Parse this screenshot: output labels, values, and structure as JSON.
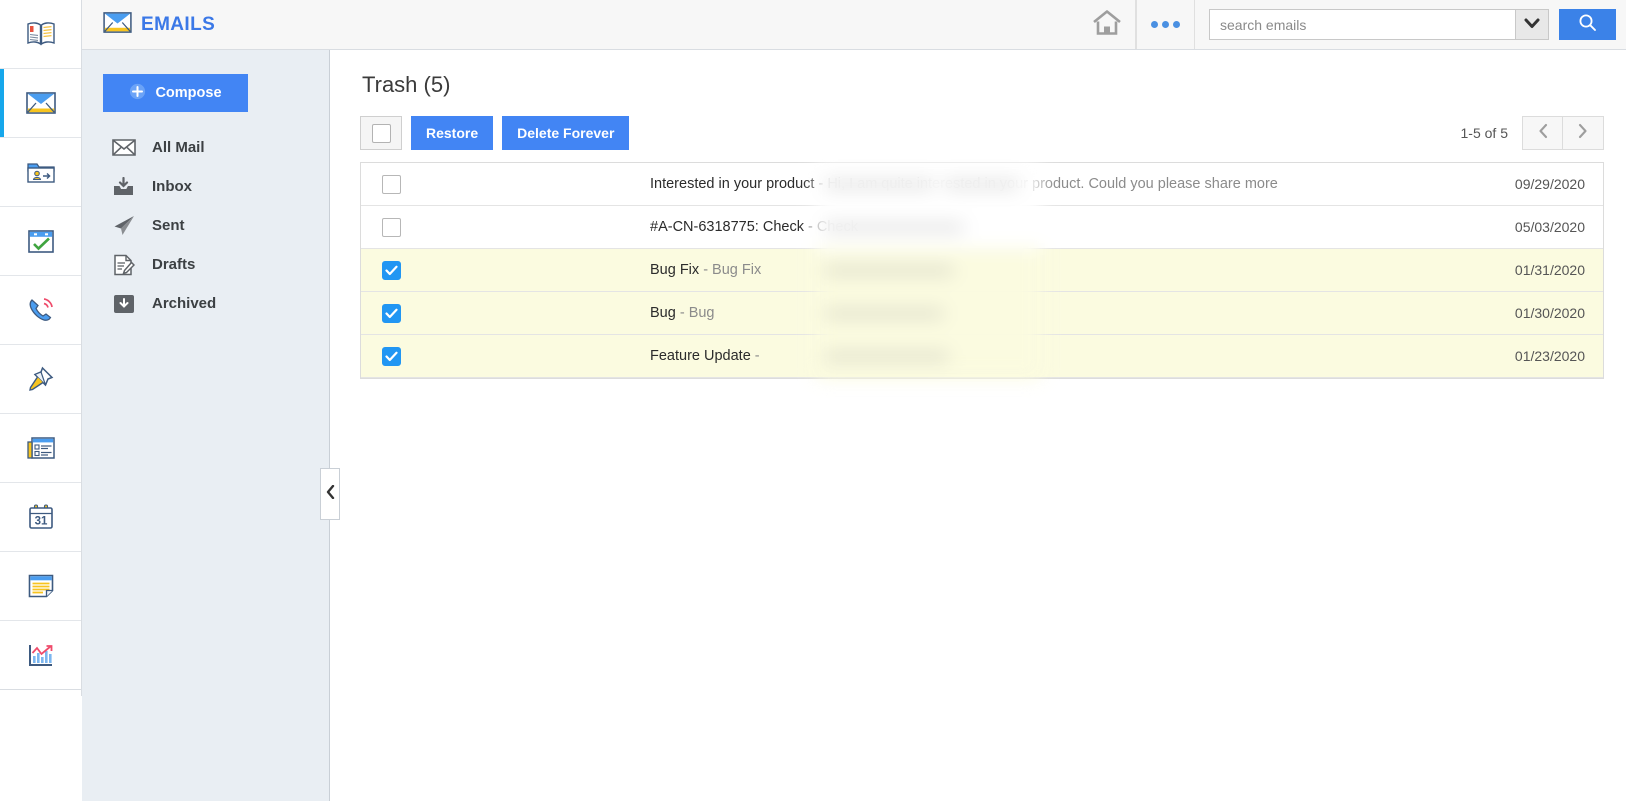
{
  "app": {
    "brand_title": "EMAILS",
    "brand_icon": "envelope-icon"
  },
  "icon_rail": {
    "items": [
      {
        "name": "address-book",
        "icon": "book-icon",
        "active": false
      },
      {
        "name": "emails",
        "icon": "envelope-icon",
        "active": true
      },
      {
        "name": "contacts",
        "icon": "contact-folder-icon",
        "active": false
      },
      {
        "name": "tasks",
        "icon": "calendar-check-icon",
        "active": false
      },
      {
        "name": "calls",
        "icon": "phone-icon",
        "active": false
      },
      {
        "name": "pinned",
        "icon": "pin-icon",
        "active": false
      },
      {
        "name": "news",
        "icon": "news-icon",
        "active": false
      },
      {
        "name": "calendar",
        "icon": "calendar-31-icon",
        "active": false
      },
      {
        "name": "notes",
        "icon": "notes-icon",
        "active": false
      },
      {
        "name": "reports",
        "icon": "chart-icon",
        "active": false
      }
    ]
  },
  "header": {
    "home_label": "home-icon",
    "more_label": "more-options-icon",
    "search": {
      "placeholder": "search emails",
      "value": "",
      "dropdown_icon": "chevron-down-icon",
      "submit_icon": "search-icon"
    }
  },
  "sidebar": {
    "compose_label": "Compose",
    "compose_icon": "plus-circle-icon",
    "items": [
      {
        "label": "All Mail",
        "icon": "envelope-outline-icon"
      },
      {
        "label": "Inbox",
        "icon": "inbox-icon"
      },
      {
        "label": "Sent",
        "icon": "paper-plane-icon"
      },
      {
        "label": "Drafts",
        "icon": "draft-pencil-icon"
      },
      {
        "label": "Archived",
        "icon": "archive-icon"
      }
    ],
    "collapse_icon": "chevron-left-icon"
  },
  "main": {
    "page_title": "Trash (5)",
    "toolbar": {
      "select_all_checked": false,
      "restore_label": "Restore",
      "delete_forever_label": "Delete Forever",
      "pager_label": "1-5 of 5",
      "prev_icon": "chevron-left-icon",
      "next_icon": "chevron-right-icon"
    },
    "emails": [
      {
        "checked": false,
        "sender": "",
        "subject": "Interested in your product",
        "snippet": "Hi, I am quite interested in your product. Could you please share more",
        "date": "09/29/2020",
        "selected": false
      },
      {
        "checked": false,
        "sender": "",
        "subject": "#A-CN-6318775: Check",
        "snippet": "Check",
        "date": "05/03/2020",
        "selected": false
      },
      {
        "checked": true,
        "sender": "",
        "subject": "Bug Fix",
        "snippet": "Bug Fix",
        "date": "01/31/2020",
        "selected": true
      },
      {
        "checked": true,
        "sender": "",
        "subject": "Bug",
        "snippet": "Bug",
        "date": "01/30/2020",
        "selected": true
      },
      {
        "checked": true,
        "sender": "",
        "subject": "Feature Update",
        "snippet": "",
        "date": "01/23/2020",
        "selected": true
      }
    ]
  },
  "colors": {
    "accent_blue": "#4285f4",
    "brand_blue": "#3b78e7",
    "active_rail": "#16a7eb",
    "selected_row": "#fbfbe0",
    "sidebar_bg": "#e9eef3"
  }
}
